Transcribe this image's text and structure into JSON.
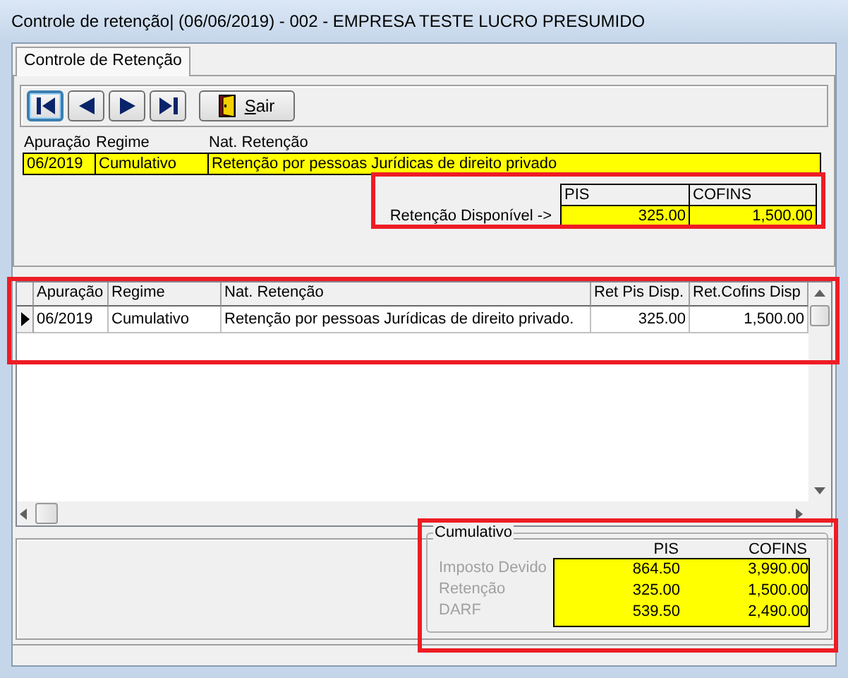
{
  "window": {
    "title": "Controle de retenção| (06/06/2019) - 002 - EMPRESA TESTE LUCRO PRESUMIDO"
  },
  "tabs": [
    {
      "label": "Controle de Retenção",
      "selected": true
    }
  ],
  "toolbar": [
    {
      "kind": "first",
      "focused": true
    },
    {
      "kind": "prev",
      "focused": false
    },
    {
      "kind": "next",
      "focused": false
    },
    {
      "kind": "last",
      "focused": false
    },
    {
      "kind": "exit",
      "label": "Sair",
      "focused": false
    }
  ],
  "record": {
    "columns": [
      "Apuração",
      "Regime",
      "Nat. Retenção"
    ],
    "values": [
      "06/2019",
      "Cumulativo",
      "Retenção por pessoas Jurídicas de direito privado"
    ]
  },
  "available": {
    "label": "Retenção Disponível ->",
    "columns": [
      "PIS",
      "COFINS"
    ],
    "values": [
      "325.00",
      "1,500.00"
    ]
  },
  "grid": {
    "columns": [
      "Apuração",
      "Regime",
      "Nat. Retenção",
      "Ret Pis Disp.",
      "Ret.Cofins Disp"
    ],
    "rows": [
      {
        "selected": true,
        "cells": [
          "06/2019",
          "Cumulativo",
          "Retenção por pessoas Jurídicas de direito privado.",
          "325.00",
          "1,500.00"
        ]
      }
    ]
  },
  "totals": {
    "title": "Cumulativo",
    "columns": [
      "PIS",
      "COFINS"
    ],
    "rows": [
      {
        "label": "Imposto Devido",
        "disabled": true,
        "values": [
          "864.50",
          "3,990.00"
        ]
      },
      {
        "label": "Retenção",
        "disabled": true,
        "values": [
          "325.00",
          "1,500.00"
        ]
      },
      {
        "label": "DARF",
        "disabled": true,
        "values": [
          "539.50",
          "2,490.00"
        ]
      }
    ]
  }
}
